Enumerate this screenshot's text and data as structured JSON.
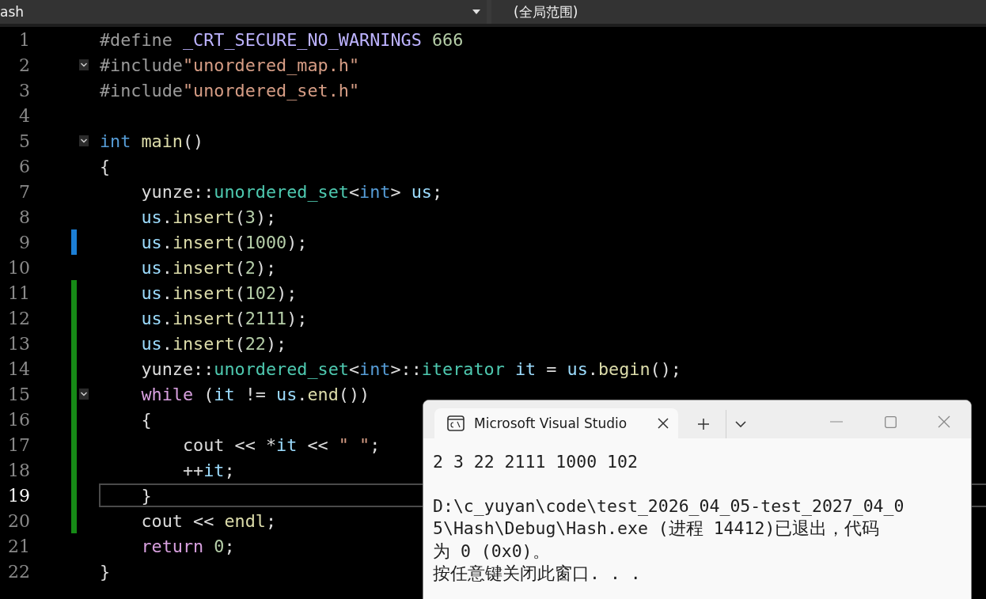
{
  "toolbar": {
    "file_dropdown": "ash",
    "scope_dropdown": "(全局范围)"
  },
  "editor": {
    "lines": [
      {
        "number": "1",
        "tokens": [
          {
            "kind": "pre",
            "text": "#define "
          },
          {
            "kind": "macro",
            "text": "_CRT_SECURE_NO_WARNINGS"
          },
          {
            "kind": "num",
            "text": " 666"
          }
        ]
      },
      {
        "number": "2",
        "expanded": true,
        "tokens": [
          {
            "kind": "pre",
            "text": "#include"
          },
          {
            "kind": "str",
            "text": "\"unordered_map.h\""
          }
        ]
      },
      {
        "number": "3",
        "tokens": [
          {
            "kind": "pre",
            "text": "#include"
          },
          {
            "kind": "str",
            "text": "\"unordered_set.h\""
          }
        ]
      },
      {
        "number": "4"
      },
      {
        "number": "5",
        "expanded": true,
        "tokens": [
          {
            "kind": "kw",
            "text": "int "
          },
          {
            "kind": "func",
            "text": "main"
          },
          {
            "kind": "plain",
            "text": "()"
          }
        ]
      },
      {
        "number": "6",
        "tokens": [
          {
            "kind": "plain",
            "text": "{"
          }
        ]
      },
      {
        "number": "7",
        "tokens": [
          {
            "kind": "plain",
            "text": "    yunze::"
          },
          {
            "kind": "type",
            "text": "unordered_set"
          },
          {
            "kind": "plain",
            "text": "<"
          },
          {
            "kind": "kw",
            "text": "int"
          },
          {
            "kind": "plain",
            "text": ">"
          },
          {
            "kind": "var",
            "text": " us"
          },
          {
            "kind": "plain",
            "text": ";"
          }
        ]
      },
      {
        "number": "8",
        "tokens": [
          {
            "kind": "var",
            "text": "    us"
          },
          {
            "kind": "plain",
            "text": "."
          },
          {
            "kind": "func",
            "text": "insert"
          },
          {
            "kind": "plain",
            "text": "("
          },
          {
            "kind": "num",
            "text": "3"
          },
          {
            "kind": "plain",
            "text": ");"
          }
        ]
      },
      {
        "number": "9",
        "color": "#1c7fd6",
        "tokens": [
          {
            "kind": "var",
            "text": "    us"
          },
          {
            "kind": "plain",
            "text": "."
          },
          {
            "kind": "func",
            "text": "insert"
          },
          {
            "kind": "plain",
            "text": "("
          },
          {
            "kind": "num",
            "text": "1000"
          },
          {
            "kind": "plain",
            "text": ");"
          }
        ]
      },
      {
        "number": "10",
        "tokens": [
          {
            "kind": "var",
            "text": "    us"
          },
          {
            "kind": "plain",
            "text": "."
          },
          {
            "kind": "func",
            "text": "insert"
          },
          {
            "kind": "plain",
            "text": "("
          },
          {
            "kind": "num",
            "text": "2"
          },
          {
            "kind": "plain",
            "text": ");"
          }
        ]
      },
      {
        "number": "11",
        "color": "#168a16",
        "tokens": [
          {
            "kind": "var",
            "text": "    us"
          },
          {
            "kind": "plain",
            "text": "."
          },
          {
            "kind": "func",
            "text": "insert"
          },
          {
            "kind": "plain",
            "text": "("
          },
          {
            "kind": "num",
            "text": "102"
          },
          {
            "kind": "plain",
            "text": ");"
          }
        ]
      },
      {
        "number": "12",
        "color": "#168a16",
        "tokens": [
          {
            "kind": "var",
            "text": "    us"
          },
          {
            "kind": "plain",
            "text": "."
          },
          {
            "kind": "func",
            "text": "insert"
          },
          {
            "kind": "plain",
            "text": "("
          },
          {
            "kind": "num",
            "text": "2111"
          },
          {
            "kind": "plain",
            "text": ");"
          }
        ]
      },
      {
        "number": "13",
        "color": "#168a16",
        "tokens": [
          {
            "kind": "var",
            "text": "    us"
          },
          {
            "kind": "plain",
            "text": "."
          },
          {
            "kind": "func",
            "text": "insert"
          },
          {
            "kind": "plain",
            "text": "("
          },
          {
            "kind": "num",
            "text": "22"
          },
          {
            "kind": "plain",
            "text": ");"
          }
        ]
      },
      {
        "number": "14",
        "color": "#168a16",
        "tokens": [
          {
            "kind": "plain",
            "text": "    yunze::"
          },
          {
            "kind": "type",
            "text": "unordered_set"
          },
          {
            "kind": "plain",
            "text": "<"
          },
          {
            "kind": "kw",
            "text": "int"
          },
          {
            "kind": "plain",
            "text": ">::"
          },
          {
            "kind": "type",
            "text": "iterator"
          },
          {
            "kind": "var",
            "text": " it"
          },
          {
            "kind": "plain",
            "text": " = "
          },
          {
            "kind": "var",
            "text": "us"
          },
          {
            "kind": "plain",
            "text": "."
          },
          {
            "kind": "func",
            "text": "begin"
          },
          {
            "kind": "plain",
            "text": "();"
          }
        ]
      },
      {
        "number": "15",
        "color": "#168a16",
        "expanded": true,
        "tokens": [
          {
            "kind": "ctl",
            "text": "    while"
          },
          {
            "kind": "plain",
            "text": " ("
          },
          {
            "kind": "var",
            "text": "it"
          },
          {
            "kind": "plain",
            "text": " != "
          },
          {
            "kind": "var",
            "text": "us"
          },
          {
            "kind": "plain",
            "text": "."
          },
          {
            "kind": "func",
            "text": "end"
          },
          {
            "kind": "plain",
            "text": "())"
          }
        ]
      },
      {
        "number": "16",
        "color": "#168a16",
        "tokens": [
          {
            "kind": "plain",
            "text": "    {"
          }
        ]
      },
      {
        "number": "17",
        "color": "#168a16",
        "tokens": [
          {
            "kind": "plain",
            "text": "        cout << *"
          },
          {
            "kind": "var",
            "text": "it"
          },
          {
            "kind": "plain",
            "text": " << "
          },
          {
            "kind": "str",
            "text": "\" \""
          },
          {
            "kind": "plain",
            "text": ";"
          }
        ]
      },
      {
        "number": "18",
        "color": "#168a16",
        "tokens": [
          {
            "kind": "plain",
            "text": "        ++"
          },
          {
            "kind": "var",
            "text": "it"
          },
          {
            "kind": "plain",
            "text": ";"
          }
        ]
      },
      {
        "number": "19",
        "color": "#168a16",
        "current": true,
        "tokens": [
          {
            "kind": "plain",
            "text": "    }"
          }
        ]
      },
      {
        "number": "20",
        "color": "#168a16",
        "tokens": [
          {
            "kind": "plain",
            "text": "    cout << "
          },
          {
            "kind": "func",
            "text": "endl"
          },
          {
            "kind": "plain",
            "text": ";"
          }
        ]
      },
      {
        "number": "21",
        "tokens": [
          {
            "kind": "ctl",
            "text": "    return"
          },
          {
            "kind": "num",
            "text": " 0"
          },
          {
            "kind": "plain",
            "text": ";"
          }
        ]
      },
      {
        "number": "22",
        "tokens": [
          {
            "kind": "plain",
            "text": "}"
          }
        ]
      }
    ]
  },
  "console": {
    "tab_title": "Microsoft Visual Studio",
    "tab_selected": true,
    "output": [
      "2 3 22 2111 1000 102",
      "D:\\c_yuyan\\code\\test_2026_04_05-test_2027_04_0",
      "5\\Hash\\Debug\\Hash.exe (进程 14412)已退出，代码",
      "为 0 (0x0)。",
      "按任意键关闭此窗口. . ."
    ]
  }
}
